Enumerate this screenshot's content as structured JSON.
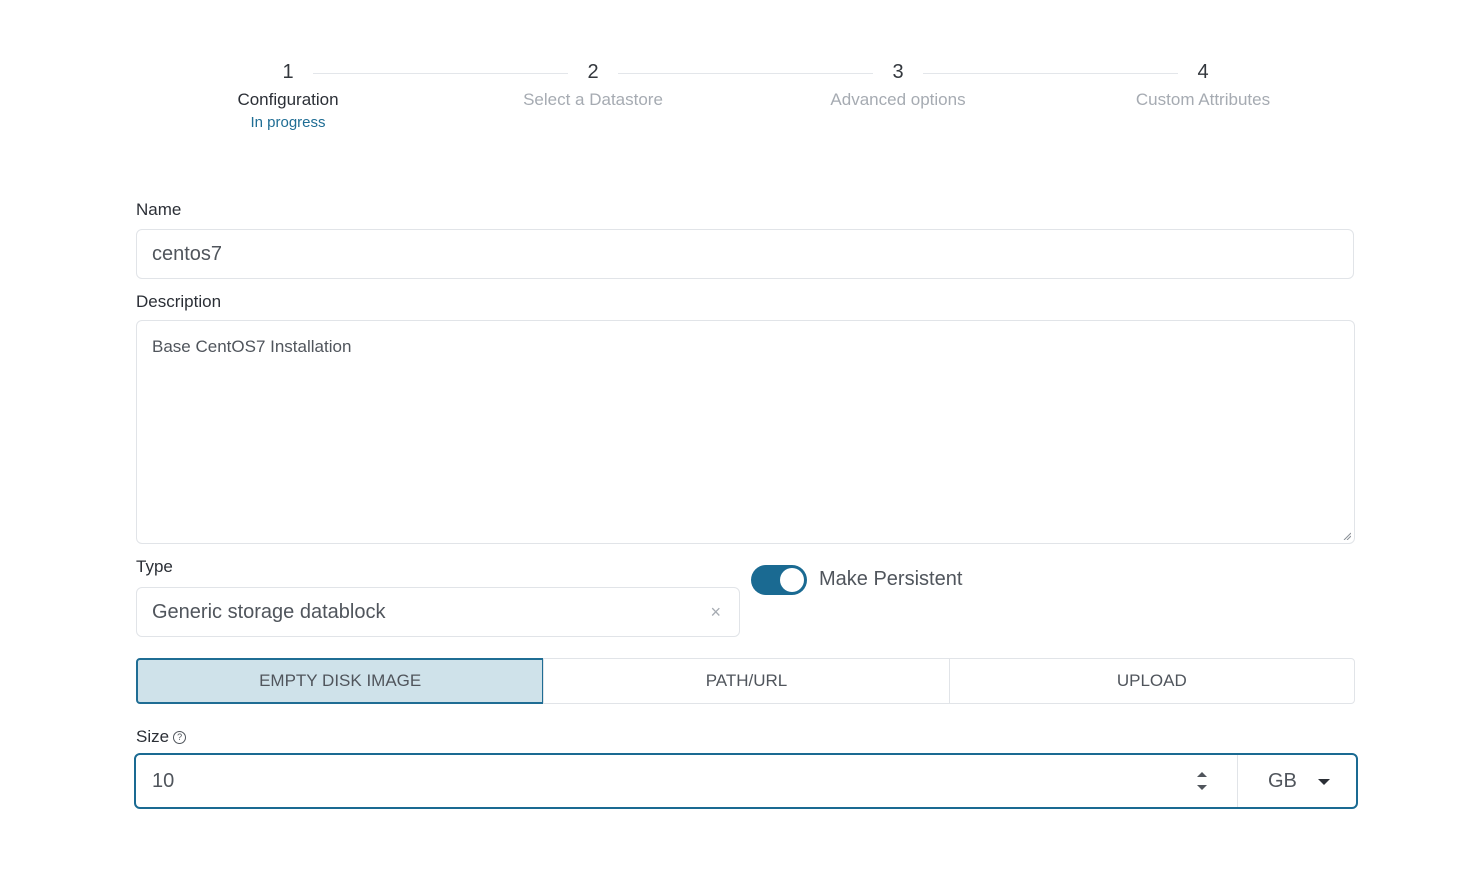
{
  "stepper": {
    "steps": [
      {
        "number": "1",
        "title": "Configuration",
        "subtitle": "In progress"
      },
      {
        "number": "2",
        "title": "Select a Datastore"
      },
      {
        "number": "3",
        "title": "Advanced options"
      },
      {
        "number": "4",
        "title": "Custom Attributes"
      }
    ]
  },
  "form": {
    "name_label": "Name",
    "name_value": "centos7",
    "description_label": "Description",
    "description_value": "Base CentOS7 Installation",
    "type_label": "Type",
    "type_value": "Generic storage datablock",
    "clear_glyph": "×",
    "persistent_label": "Make Persistent",
    "persistent_on": true,
    "source_tabs": [
      "EMPTY DISK IMAGE",
      "PATH/URL",
      "UPLOAD"
    ],
    "source_selected": "EMPTY DISK IMAGE",
    "size_label": "Size",
    "help_glyph": "?",
    "size_value": "10",
    "size_unit": "GB"
  },
  "colors": {
    "accent": "#1a6a92",
    "tab_selected_bg": "#cfe2ea",
    "muted_text": "#a6abb2"
  },
  "icons": [
    "clear-icon",
    "help-icon",
    "spinner-icon",
    "chevron-down-icon"
  ]
}
